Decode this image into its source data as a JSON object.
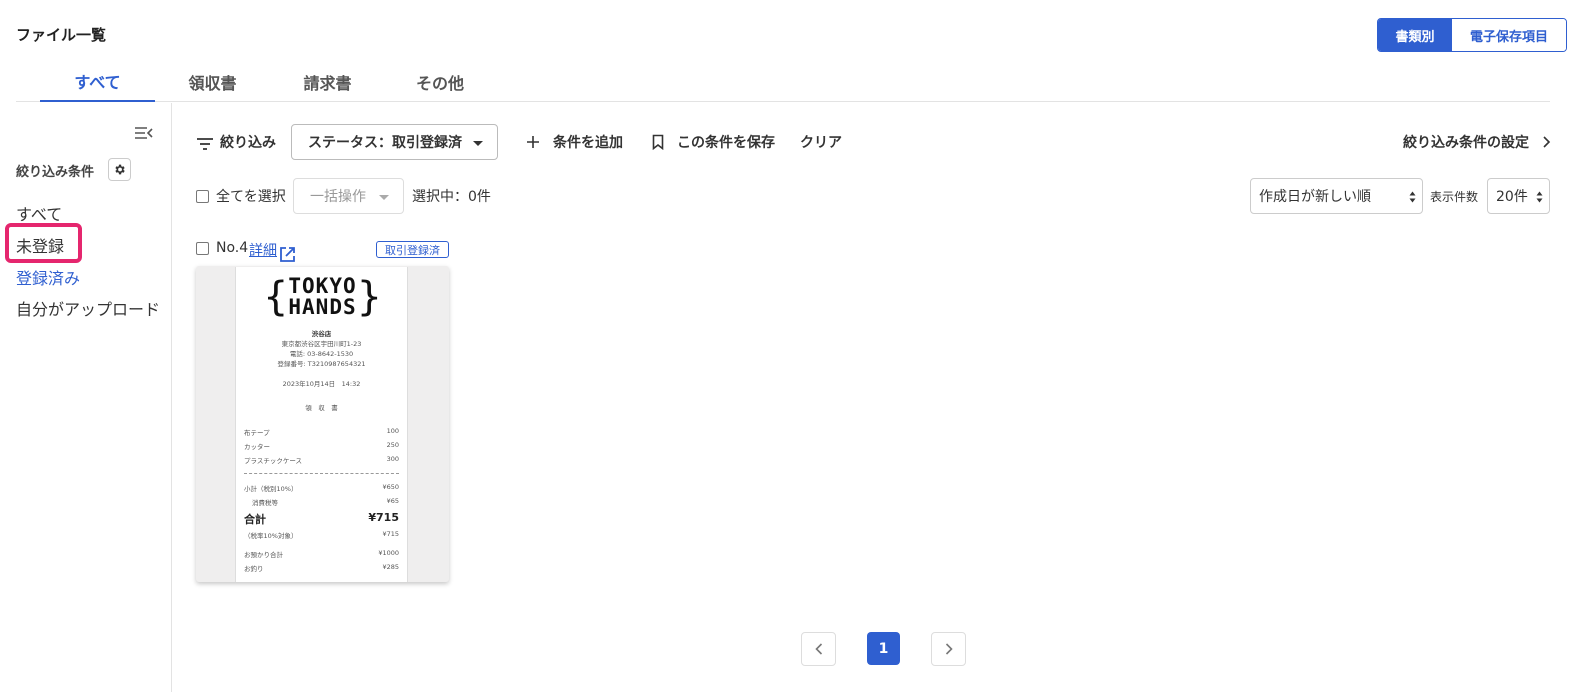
{
  "page_title": "ファイル一覧",
  "view_toggle": {
    "active": "書類別",
    "inactive": "電子保存項目"
  },
  "tabs": [
    {
      "label": "すべて"
    },
    {
      "label": "領収書"
    },
    {
      "label": "請求書"
    },
    {
      "label": "その他"
    }
  ],
  "sidebar": {
    "heading": "絞り込み条件",
    "items": [
      {
        "label": "すべて"
      },
      {
        "label": "未登録"
      },
      {
        "label": "登録済み"
      },
      {
        "label": "自分がアップロード"
      }
    ]
  },
  "filter_bar": {
    "filter_label": "絞り込み",
    "status_select": "ステータス：取引登録済",
    "add_condition": "条件を追加",
    "save_condition": "この条件を保存",
    "clear": "クリア",
    "settings": "絞り込み条件の設定"
  },
  "list_controls": {
    "select_all": "全てを選択",
    "bulk_action": "一括操作",
    "selected_count": "選択中：0件",
    "sort": "作成日が新しい順",
    "per_page_label": "表示件数",
    "per_page": "20件"
  },
  "card": {
    "number": "No.4",
    "detail_link": "詳細",
    "status_badge": "取引登録済"
  },
  "receipt": {
    "logo_top": "TOKYO",
    "logo_bottom": "HANDS",
    "store": "渋谷店",
    "address": "東京都渋谷区宇田川町1-23",
    "phone": "電話: 03-8642-1530",
    "reg_no": "登録番号: T3210987654321",
    "datetime": "2023年10月14日　14:32",
    "doc_title": "領　収　書",
    "items": [
      {
        "name": "布テープ",
        "price": "100"
      },
      {
        "name": "カッター",
        "price": "250"
      },
      {
        "name": "プラスチックケース",
        "price": "300"
      }
    ],
    "subtotal_label": "小計（税別10%）",
    "subtotal": "¥650",
    "tax_label": "消費税等",
    "tax": "¥65",
    "total_label": "合計",
    "total": "¥715",
    "tax_target_label": "（税率10%対象）",
    "tax_target": "¥715",
    "received_label": "お預かり合計",
    "received": "¥1000",
    "change_label": "お釣り",
    "change": "¥285"
  },
  "pagination": {
    "current": "1"
  },
  "colors": {
    "accent": "#2f5fd0",
    "highlight": "#e5266e"
  }
}
